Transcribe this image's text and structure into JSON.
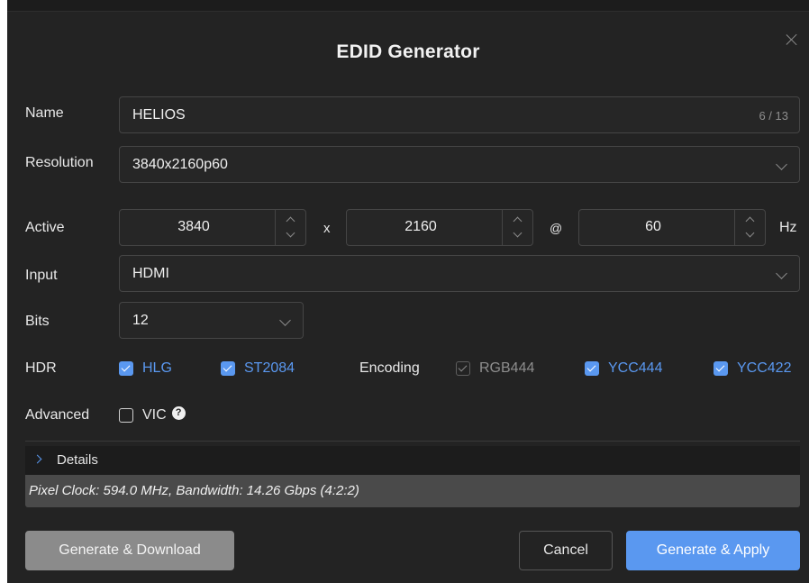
{
  "dialog": {
    "title": "EDID Generator"
  },
  "name": {
    "label": "Name",
    "value": "HELIOS",
    "counter": "6 / 13"
  },
  "resolution": {
    "label": "Resolution",
    "value": "3840x2160p60"
  },
  "active": {
    "label": "Active",
    "width": "3840",
    "times": "x",
    "height": "2160",
    "at": "@",
    "refresh": "60",
    "unit": "Hz"
  },
  "input": {
    "label": "Input",
    "value": "HDMI"
  },
  "bits": {
    "label": "Bits",
    "value": "12"
  },
  "hdr": {
    "label": "HDR",
    "options": [
      {
        "label": "HLG",
        "checked": true
      },
      {
        "label": "ST2084",
        "checked": true
      }
    ]
  },
  "encoding": {
    "label": "Encoding",
    "options": [
      {
        "label": "RGB444",
        "checked": true,
        "disabled": true
      },
      {
        "label": "YCC444",
        "checked": true
      },
      {
        "label": "YCC422",
        "checked": true
      }
    ]
  },
  "advanced": {
    "label": "Advanced",
    "vic_label": "VIC",
    "vic_checked": false,
    "help_glyph": "?"
  },
  "details": {
    "label": "Details",
    "info": "Pixel Clock: 594.0 MHz, Bandwidth: 14.26 Gbps (4:2:2)"
  },
  "buttons": {
    "download": "Generate & Download",
    "cancel": "Cancel",
    "apply": "Generate & Apply"
  },
  "colors": {
    "accent": "#5a98f0",
    "background": "#232323",
    "disabled_button": "#8b8b8b"
  }
}
